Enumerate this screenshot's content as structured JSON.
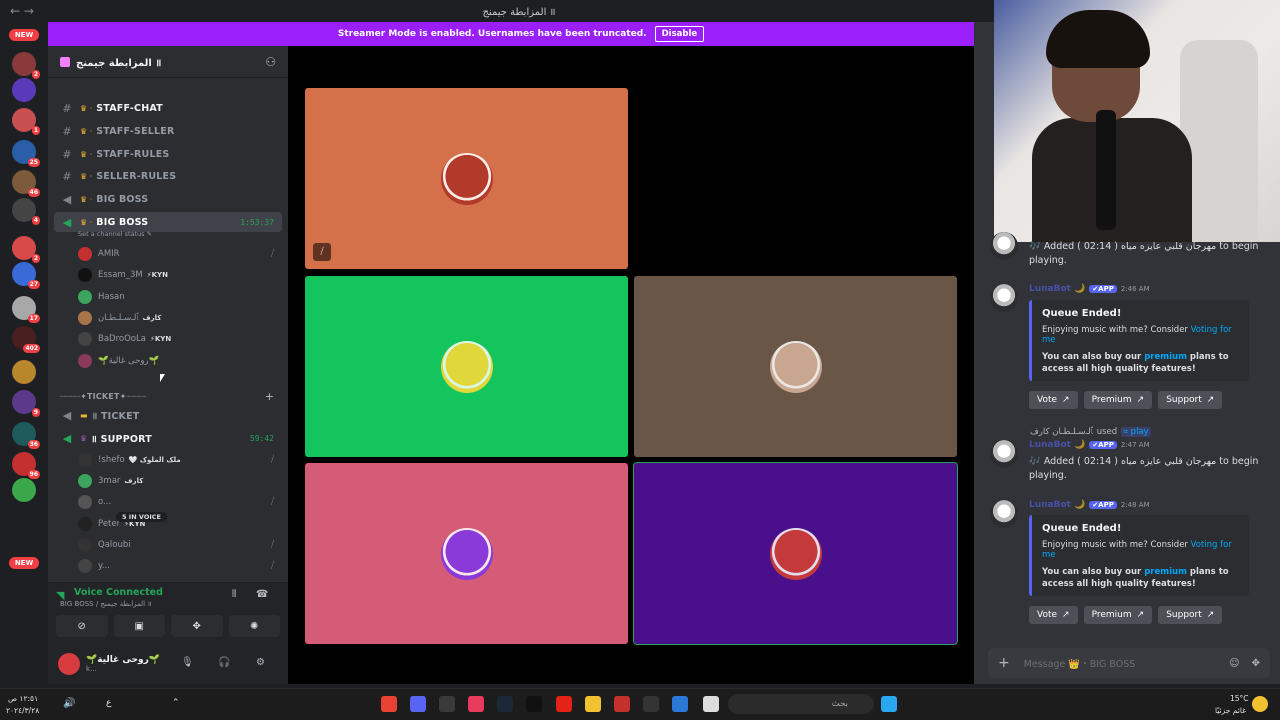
{
  "window": {
    "title": "المزابطة جيمنج ॥",
    "nav_back": "←",
    "nav_forward": "→"
  },
  "banner": {
    "text": "Streamer Mode is enabled. Usernames have been truncated.",
    "button": "Disable"
  },
  "rail": {
    "new_top": "NEW",
    "new_bottom": "NEW",
    "servers": [
      {
        "badge": "2",
        "color": "#8a3a3a"
      },
      {
        "badge": "",
        "color": "#5a3ab8"
      },
      {
        "badge": "1",
        "color": "#c74f4f"
      },
      {
        "badge": "25",
        "color": "#2b5ea8"
      },
      {
        "badge": "46",
        "color": "#7a5a3a"
      },
      {
        "badge": "4",
        "color": "#444"
      },
      {
        "badge": "2",
        "color": "#d84a4a"
      },
      {
        "badge": "27",
        "color": "#3a6ad8"
      },
      {
        "badge": "17",
        "color": "#a8a8a8"
      },
      {
        "badge": "402",
        "color": "#4a1f1f"
      },
      {
        "badge": "",
        "color": "#b8862b"
      },
      {
        "badge": "9",
        "color": "#5b3a8a"
      },
      {
        "badge": "36",
        "color": "#1f5a5a"
      },
      {
        "badge": "96",
        "color": "#c43030"
      },
      {
        "badge": "",
        "color": "#3aa84a"
      }
    ]
  },
  "sidebar": {
    "server_name": "المزابطة جيمنج ॥",
    "channels": [
      {
        "icon": "#",
        "name": "STAFF-CHAT",
        "crown": true,
        "bright": true
      },
      {
        "icon": "#",
        "name": "STAFF-SELLER",
        "crown": true
      },
      {
        "icon": "#",
        "name": "STAFF-RULES",
        "crown": true
      },
      {
        "icon": "#",
        "name": "SELLER-RULES",
        "crown": true
      },
      {
        "icon": "🔊",
        "name": "BIG BOSS",
        "crown": true
      }
    ],
    "active_channel": {
      "name": "BIG BOSS",
      "time": "1:53:37",
      "status": "Set a channel status ✎"
    },
    "voice_users_1": [
      {
        "name": "AMIR",
        "tag": "",
        "color": "#c43030",
        "muted": true
      },
      {
        "name": "Essam_3M",
        "tag": "⚡KYN",
        "color": "#111",
        "muted": false
      },
      {
        "name": "Hasan",
        "tag": "",
        "color": "#3ba55d",
        "muted": false
      },
      {
        "name": "ﭑلـﺳـﻠـﻄـﺎن",
        "tag": "كارف",
        "color": "#a8744a",
        "muted": false
      },
      {
        "name": "BaDroOoLa",
        "tag": "⚡KYN",
        "color": "#444",
        "muted": false
      },
      {
        "name": "🌱ﺭﻭﺣﯽ ﻏﺎﻟﯿﺔ🌱",
        "tag": "",
        "color": "#8a3a5a",
        "muted": false
      }
    ],
    "category": "┈┈┈┈✦TICKET✦┈┈┈┈",
    "ticket_channel": {
      "icon": "🔊",
      "name": "॥ TICKET"
    },
    "support_channel": {
      "icon": "🔊",
      "name": "॥ SUPPORT",
      "time": "59:42"
    },
    "voice_users_2": [
      {
        "name": "!shefo",
        "tag": "🤍 ﻣﻠﮏ ﺍﻟﻤﻠﻮﮎ",
        "color": "#333",
        "muted": true
      },
      {
        "name": "3mar",
        "tag": "كارف",
        "color": "#3ba55d",
        "muted": false
      },
      {
        "name": "o...",
        "tag": "",
        "color": "#555",
        "muted": true
      },
      {
        "name": "Peter",
        "tag": "⚡KYN",
        "color": "#222",
        "muted": false
      },
      {
        "name": "Qaloubi",
        "tag": "",
        "color": "#333",
        "muted": true
      },
      {
        "name": "y...",
        "tag": "",
        "color": "#444",
        "muted": true
      }
    ],
    "in_voice_pill": "5 IN VOICE"
  },
  "voice_panel": {
    "status": "Voice Connected",
    "subtitle": "BIG BOSS / المزابطة جيمنج ॥"
  },
  "user_panel": {
    "name": "🌱ﺭﻭﺣﯽ ﻏﺎﻟﯿﺔ🌱",
    "sub": "k..."
  },
  "stage": {
    "tiles": [
      {
        "color": "#d4704a",
        "avatar": "#b23a2a",
        "muted": true
      },
      {
        "color": "#000000",
        "avatar": "",
        "muted": false
      },
      {
        "color": "#14c45c",
        "avatar": "#e0d83a",
        "muted": false
      },
      {
        "color": "#6a5646",
        "avatar": "#c8a690",
        "muted": false
      },
      {
        "color": "#d45c76",
        "avatar": "#8a3ad8",
        "muted": false
      },
      {
        "color": "#4a0f8a",
        "avatar": "#c43a3a",
        "muted": false,
        "selected": true
      }
    ]
  },
  "chat": {
    "added_line_1": "🎶 Added ( 02:14 ) مهرجان قلبي عايزه مياه to begin playing.",
    "msg1": {
      "author": "LunaBot 🌙",
      "app": "✔APP",
      "time": "2:46 AM"
    },
    "embed_title": "Queue Ended!",
    "embed_desc_pre": "Enjoying music with me? Consider ",
    "embed_desc_link": "Voting for me",
    "embed_bold_pre": "You can also buy our ",
    "embed_bold_link": "premium",
    "embed_bold_post": " plans to access all high quality features!",
    "buttons": [
      "Vote",
      "Premium",
      "Support"
    ],
    "reply_user": "ﭑلـﺳـﻠـﻄـﺎن كارف",
    "reply_used": "used",
    "reply_cmd": "⌗ play",
    "msg2": {
      "author": "LunaBot 🌙",
      "app": "✔APP",
      "time": "2:47 AM"
    },
    "added_line_2": "🎶 Added ( 02:14 ) مهرجان قلبي عايزه مياه to begin playing.",
    "msg3": {
      "author": "LunaBot 🌙",
      "app": "✔APP",
      "time": "2:48 AM"
    },
    "composer_placeholder": "Message 👑・BIG BOSS"
  },
  "taskbar": {
    "time": "١٢:٥١ ص",
    "date": "٢٠٢٤/٣/٢٨",
    "search": "بحث",
    "temp": "15°C",
    "weather": "غائم جزئيًا",
    "lang": "ع"
  }
}
